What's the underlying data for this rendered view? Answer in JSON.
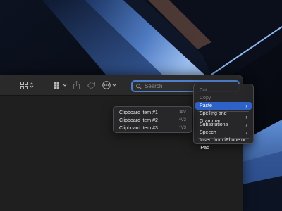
{
  "colors": {
    "accent": "#2f62c8",
    "search_focus_ring": "#4f7fcf",
    "window_bg": "#1f1f1f",
    "toolbar_bg": "#2a2a2a",
    "menu_bg": "#28282a"
  },
  "toolbar": {
    "buttons": [
      {
        "icon": "grid-view-icon",
        "has_chevron": true
      },
      {
        "icon": "group-icon",
        "has_chevron": true
      },
      {
        "icon": "share-icon",
        "has_chevron": false
      },
      {
        "icon": "tag-icon",
        "has_chevron": false
      },
      {
        "icon": "more-actions-icon",
        "has_chevron": true
      }
    ]
  },
  "search": {
    "placeholder": "Search",
    "value": ""
  },
  "context_menu": {
    "items": [
      {
        "label": "Cut",
        "enabled": false
      },
      {
        "label": "Copy",
        "enabled": false
      },
      {
        "label": "Paste",
        "enabled": true,
        "highlighted": true,
        "submenu": true
      },
      {
        "label": "Spelling and Grammar",
        "enabled": true,
        "submenu": true
      },
      {
        "label": "Substitutions",
        "enabled": true,
        "submenu": true
      },
      {
        "label": "Speech",
        "enabled": true,
        "submenu": true
      },
      {
        "label": "Insert from iPhone or iPad",
        "enabled": true
      }
    ]
  },
  "paste_submenu": {
    "items": [
      {
        "label": "Clipboard item #1",
        "shortcut": "⌘V"
      },
      {
        "label": "Clipboard item #2",
        "shortcut": "^V2"
      },
      {
        "label": "Clipboard item #3",
        "shortcut": "^V3"
      }
    ]
  }
}
